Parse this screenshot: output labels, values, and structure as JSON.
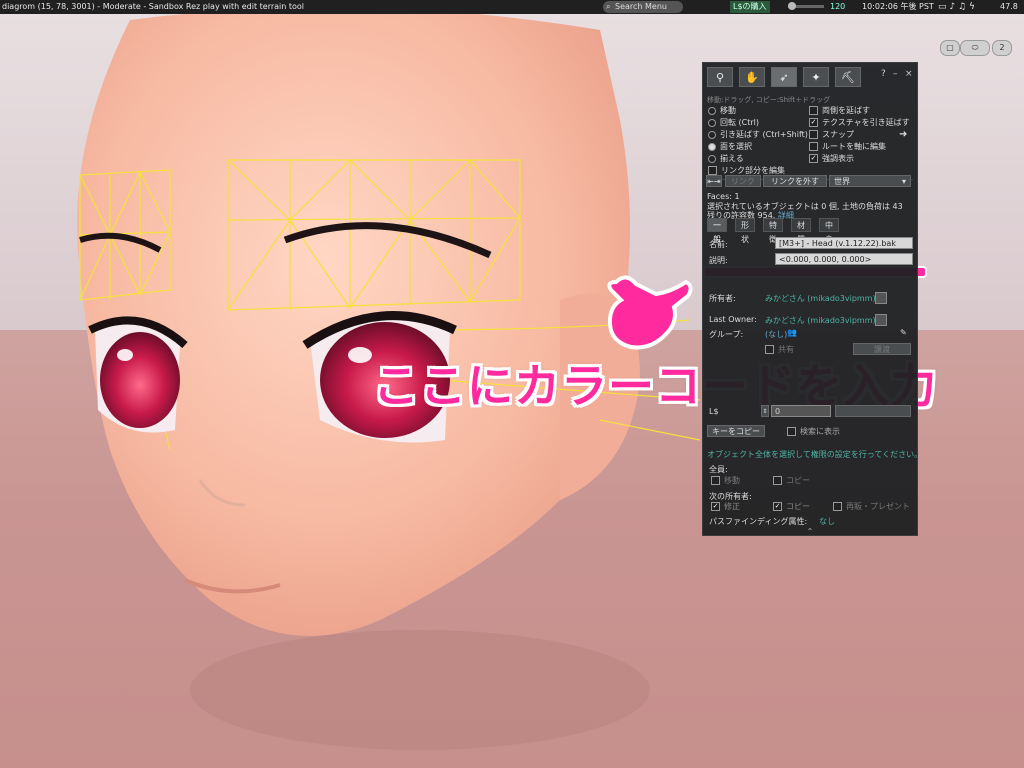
{
  "topbar": {
    "title": "diagrom (15, 78, 3001) - Moderate - Sandbox Rez play with edit terrain tool",
    "search": "Search Menu",
    "buy_ls": "L$の購入",
    "balance": "120",
    "clock": "10:02:06 午後 PST",
    "fps": "47.8",
    "tray_icons": [
      "monitor-icon",
      "speaker-icon",
      "music-icon",
      "wifi-icon"
    ]
  },
  "camera": {
    "badge": "2"
  },
  "build": {
    "tools": [
      "focus-tool",
      "move-tool",
      "edit-tool",
      "create-tool",
      "land-tool"
    ],
    "controls": {
      "help": "?",
      "minimize": "–",
      "close": "×"
    },
    "hint": "移動:ドラッグ, コピー:Shift＋ドラッグ",
    "left_options": [
      {
        "label": "移動",
        "type": "radio",
        "selected": false
      },
      {
        "label": "回転 (Ctrl)",
        "type": "radio",
        "selected": false
      },
      {
        "label": "引き延ばす (Ctrl+Shift)",
        "type": "radio",
        "selected": false
      },
      {
        "label": "面を選択",
        "type": "radio",
        "selected": true
      },
      {
        "label": "揃える",
        "type": "radio",
        "selected": false
      },
      {
        "label": "リンク部分を編集",
        "type": "check",
        "selected": false
      }
    ],
    "right_options": [
      {
        "label": "両側を延ばす",
        "checked": false
      },
      {
        "label": "テクスチャを引き延ばす",
        "checked": true
      },
      {
        "label": "スナップ",
        "checked": false
      },
      {
        "label": "ルートを軸に編集",
        "checked": false
      },
      {
        "label": "強調表示",
        "checked": true
      }
    ],
    "link_button": "リンク",
    "unlink_button": "リンクを外す",
    "ruler_select": "世界",
    "faces": "Faces: 1",
    "selection_info": "選択されているオブジェクトは 0 個, 土地の負荷は 43",
    "remaining": "残りの許容数 954.",
    "details_link": "詳細",
    "tabs": [
      "一般",
      "形状",
      "特徴",
      "材質",
      "中身"
    ],
    "active_tab": "一般",
    "name_label": "名前:",
    "name_value": "[M3+] - Head (v.1.12.22).bak",
    "desc_label": "説明:",
    "desc_value": "<0.000, 0.000, 0.000>",
    "owner_label": "所有者:",
    "owner_value": "みかどさん (mikado3vipmm)",
    "last_owner_label": "Last Owner:",
    "last_owner_value": "みかどさん (mikado3vipmm)",
    "group_label": "グループ:",
    "group_value": "(なし)",
    "share_label": "共有",
    "deed_button": "譲渡",
    "price_label": "L$",
    "price_value": "0",
    "copy_key_button": "キーをコピー",
    "search_show_label": "検索に表示",
    "perm_note": "オブジェクト全体を選択して権限の設定を行ってください。",
    "everyone_label": "全員:",
    "everyone_move": "移動",
    "everyone_copy": "コピー",
    "next_owner_label": "次の所有者:",
    "next_modify": "修正",
    "next_copy": "コピー",
    "next_transfer": "再販・プレゼント",
    "pathfinding_label": "パスファインディング属性:",
    "pathfinding_value": "なし"
  },
  "annotation": {
    "caption": "ここにカラーコードを入力",
    "accent_color": "#ff2a9d"
  }
}
